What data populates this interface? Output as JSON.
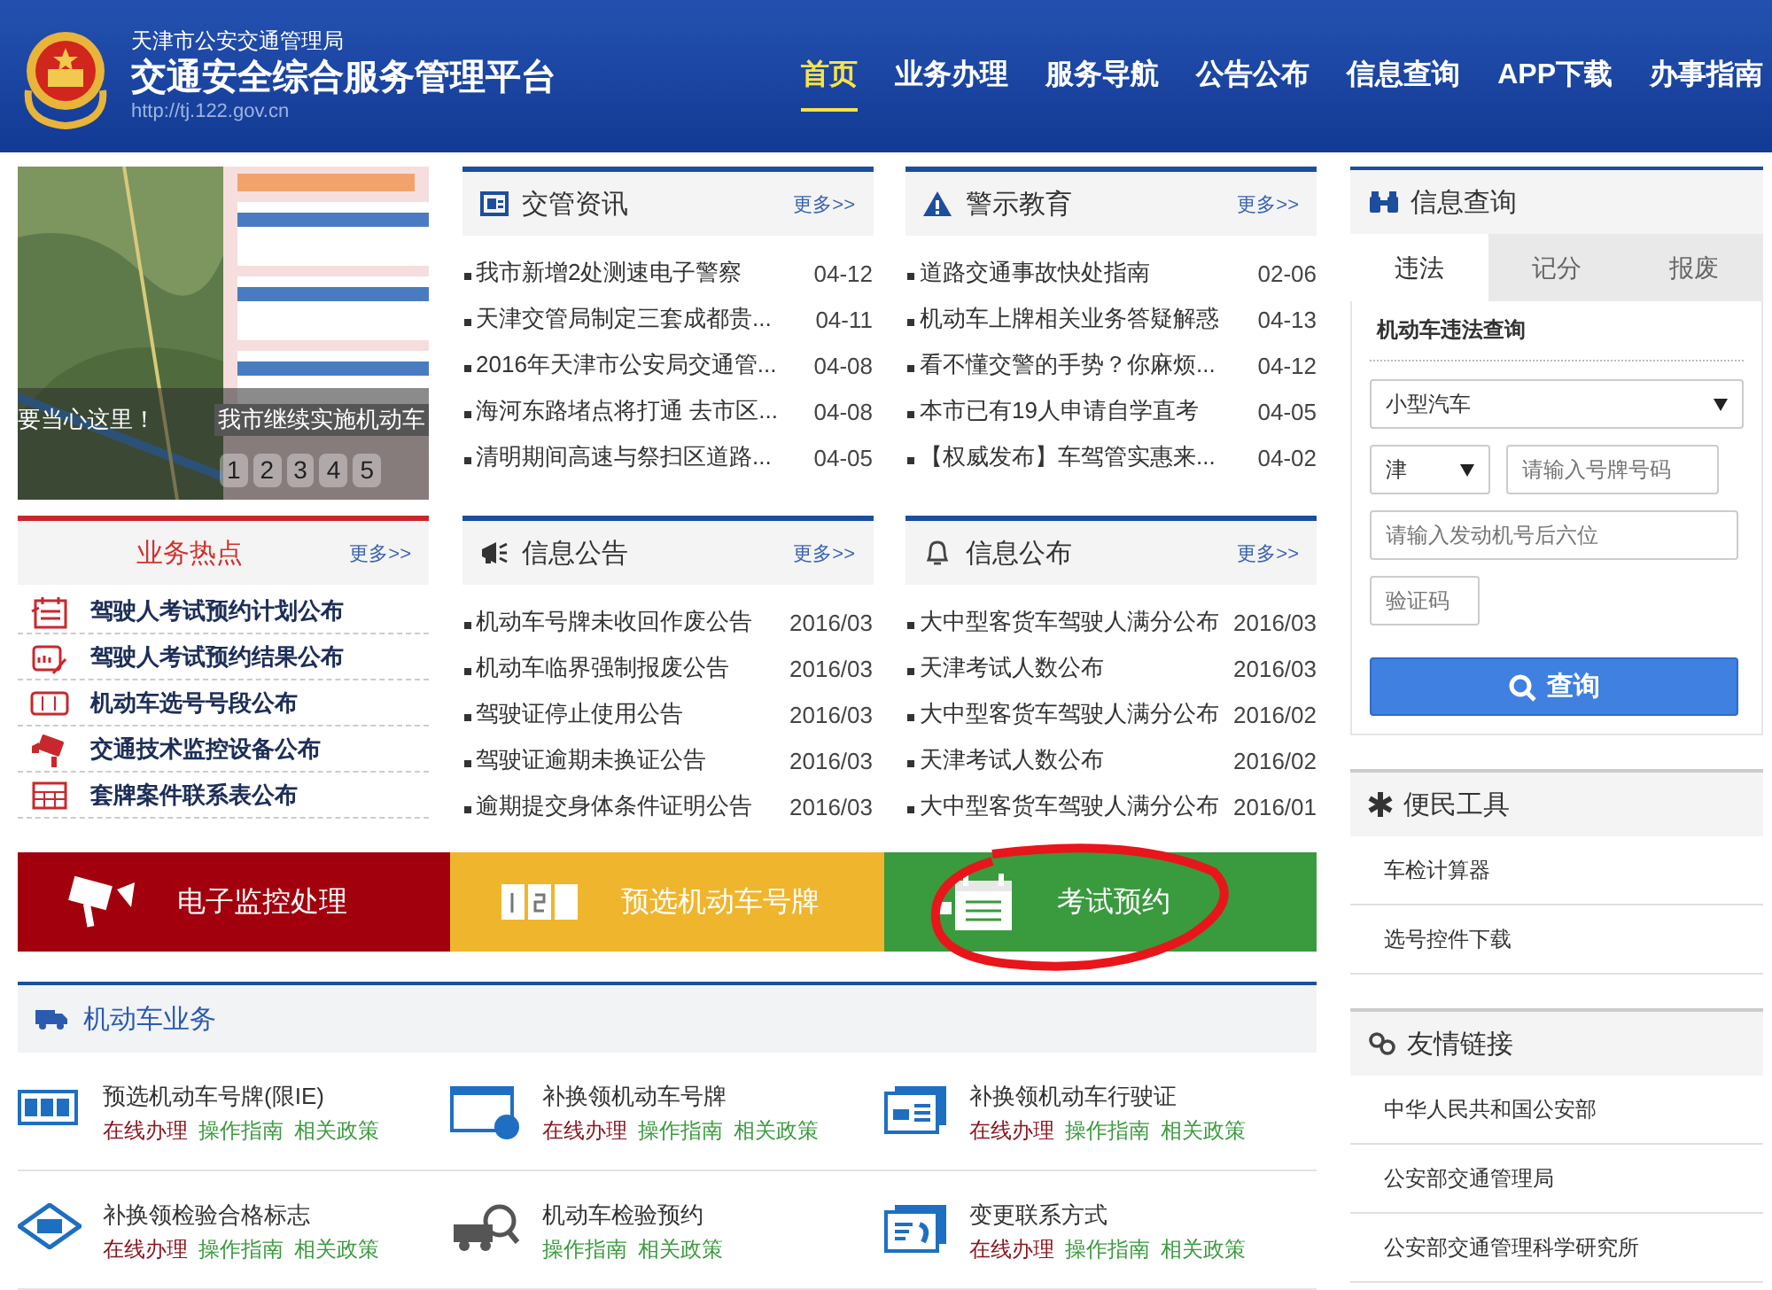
{
  "header": {
    "department": "天津市公安交通管理局",
    "title": "交通安全综合服务管理平台",
    "url": "http://tj.122.gov.cn"
  },
  "nav": [
    {
      "label": "首页",
      "selected": true
    },
    {
      "label": "业务办理",
      "selected": false
    },
    {
      "label": "服务导航",
      "selected": false
    },
    {
      "label": "公告公布",
      "selected": false
    },
    {
      "label": "信息查询",
      "selected": false
    },
    {
      "label": "APP下载",
      "selected": false
    },
    {
      "label": "办事指南",
      "selected": false
    }
  ],
  "carousel": {
    "kind": "picture",
    "captions": [
      "要当心这里！",
      "我市继续实施机动车"
    ],
    "pages": [
      "1",
      "2",
      "3",
      "4",
      "5"
    ]
  },
  "panels": [
    {
      "kind": "news",
      "title": "交管资讯",
      "more": "更多>>",
      "items": [
        {
          "text": "我市新增2处测速电子警察",
          "date": "04-12"
        },
        {
          "text": "天津交管局制定三套成都贵...",
          "date": "04-11"
        },
        {
          "text": "2016年天津市公安局交通管...",
          "date": "04-08"
        },
        {
          "text": "海河东路堵点将打通 去市区...",
          "date": "04-08"
        },
        {
          "text": "清明期间高速与祭扫区道路...",
          "date": "04-05"
        }
      ]
    },
    {
      "kind": "news",
      "title": "警示教育",
      "more": "更多>>",
      "items": [
        {
          "text": "道路交通事故快处指南",
          "date": "02-06"
        },
        {
          "text": "机动车上牌相关业务答疑解惑",
          "date": "04-13"
        },
        {
          "text": "看不懂交警的手势？你麻烦...",
          "date": "04-12"
        },
        {
          "text": "本市已有19人申请自学直考",
          "date": "04-05"
        },
        {
          "text": "【权威发布】车驾管实惠来...",
          "date": "04-02"
        }
      ]
    },
    {
      "kind": "hot",
      "title": "业务热点",
      "more": "更多>>",
      "items": [
        {
          "text": "驾驶人考试预约计划公布"
        },
        {
          "text": "驾驶人考试预约结果公布"
        },
        {
          "text": "机动车选号号段公布"
        },
        {
          "text": "交通技术监控设备公布"
        },
        {
          "text": "套牌案件联系表公布"
        }
      ]
    },
    {
      "kind": "news",
      "title": "信息公告",
      "more": "更多>>",
      "items": [
        {
          "text": "机动车号牌未收回作废公告",
          "date": "2016/03"
        },
        {
          "text": "机动车临界强制报废公告",
          "date": "2016/03"
        },
        {
          "text": "驾驶证停止使用公告",
          "date": "2016/03"
        },
        {
          "text": "驾驶证逾期未换证公告",
          "date": "2016/03"
        },
        {
          "text": "逾期提交身体条件证明公告",
          "date": "2016/03"
        }
      ]
    },
    {
      "kind": "news",
      "title": "信息公布",
      "more": "更多>>",
      "items": [
        {
          "text": "大中型客货车驾驶人满分公布",
          "date": "2016/03"
        },
        {
          "text": "天津考试人数公布",
          "date": "2016/03"
        },
        {
          "text": "大中型客货车驾驶人满分公布",
          "date": "2016/02"
        },
        {
          "text": "天津考试人数公布",
          "date": "2016/02"
        },
        {
          "text": "大中型客货车驾驶人满分公布",
          "date": "2016/01"
        }
      ]
    }
  ],
  "banners": [
    {
      "label": "电子监控处理",
      "color": "#a3000e"
    },
    {
      "label": "预选机动车号牌",
      "color": "#efb52c"
    },
    {
      "label": "考试预约",
      "color": "#3a9a3e"
    }
  ],
  "annotation": {
    "kind": "circle"
  },
  "motor": {
    "title": "机动车业务",
    "items": [
      {
        "name": "预选机动车号牌(限IE)",
        "links": [
          {
            "text": "在线办理",
            "kind": "online"
          },
          {
            "text": "操作指南",
            "kind": "guide"
          },
          {
            "text": "相关政策",
            "kind": "guide"
          }
        ]
      },
      {
        "name": "补换领机动车号牌",
        "links": [
          {
            "text": "在线办理",
            "kind": "online"
          },
          {
            "text": "操作指南",
            "kind": "guide"
          },
          {
            "text": "相关政策",
            "kind": "guide"
          }
        ]
      },
      {
        "name": "补换领机动车行驶证",
        "links": [
          {
            "text": "在线办理",
            "kind": "online"
          },
          {
            "text": "操作指南",
            "kind": "guide"
          },
          {
            "text": "相关政策",
            "kind": "guide"
          }
        ]
      },
      {
        "name": "补换领检验合格标志",
        "links": [
          {
            "text": "在线办理",
            "kind": "online"
          },
          {
            "text": "操作指南",
            "kind": "guide"
          },
          {
            "text": "相关政策",
            "kind": "guide"
          }
        ]
      },
      {
        "name": "机动车检验预约",
        "links": [
          {
            "text": "操作指南",
            "kind": "guide"
          },
          {
            "text": "相关政策",
            "kind": "guide"
          }
        ]
      },
      {
        "name": "变更联系方式",
        "links": [
          {
            "text": "在线办理",
            "kind": "online"
          },
          {
            "text": "操作指南",
            "kind": "guide"
          },
          {
            "text": "相关政策",
            "kind": "guide"
          }
        ]
      }
    ]
  },
  "query": {
    "title": "信息查询",
    "tabs": [
      {
        "label": "违法",
        "selected": true
      },
      {
        "label": "记分",
        "selected": false
      },
      {
        "label": "报废",
        "selected": false
      }
    ],
    "subtitle": "机动车违法查询",
    "vehicle_type": "小型汽车",
    "province": "津",
    "plate_placeholder": "请输入号牌号码",
    "engine_placeholder": "请输入发动机号后六位",
    "captcha_placeholder": "验证码",
    "button": "查询"
  },
  "tools": {
    "title": "便民工具",
    "items": [
      "车检计算器",
      "选号控件下载"
    ]
  },
  "links": {
    "title": "友情链接",
    "items": [
      "中华人民共和国公安部",
      "公安部交通管理局",
      "公安部交通管理科学研究所"
    ]
  }
}
